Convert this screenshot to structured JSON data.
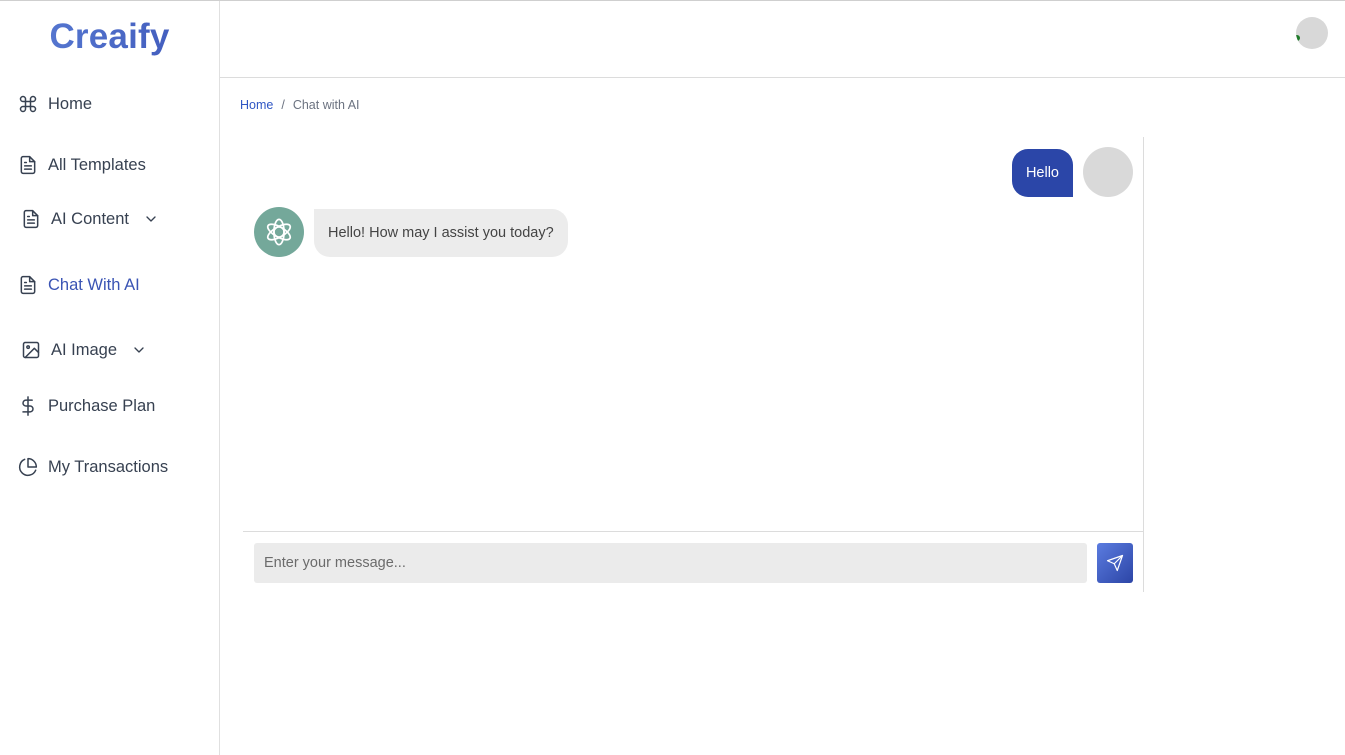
{
  "app": {
    "logo": "Creaify"
  },
  "sidebar": {
    "items": [
      {
        "label": "Home",
        "icon": "command-icon"
      },
      {
        "label": "All Templates",
        "icon": "file-text-icon"
      },
      {
        "label": "AI Content",
        "icon": "file-text-icon",
        "expandable": true
      },
      {
        "label": "Chat With AI",
        "icon": "file-text-icon",
        "active": true
      },
      {
        "label": "AI Image",
        "icon": "image-icon",
        "expandable": true
      },
      {
        "label": "Purchase Plan",
        "icon": "dollar-icon"
      },
      {
        "label": "My Transactions",
        "icon": "pie-chart-icon"
      }
    ]
  },
  "breadcrumb": {
    "home": "Home",
    "separator": "/",
    "current": "Chat with AI"
  },
  "chat": {
    "messages": [
      {
        "role": "user",
        "text": "Hello"
      },
      {
        "role": "assistant",
        "text": "Hello! How may I assist you today?"
      }
    ],
    "input": {
      "value": "",
      "placeholder": "Enter your message..."
    }
  },
  "colors": {
    "accent": "#2b46a8",
    "active_nav": "#3a54b4",
    "ai_avatar": "#74a89a"
  }
}
